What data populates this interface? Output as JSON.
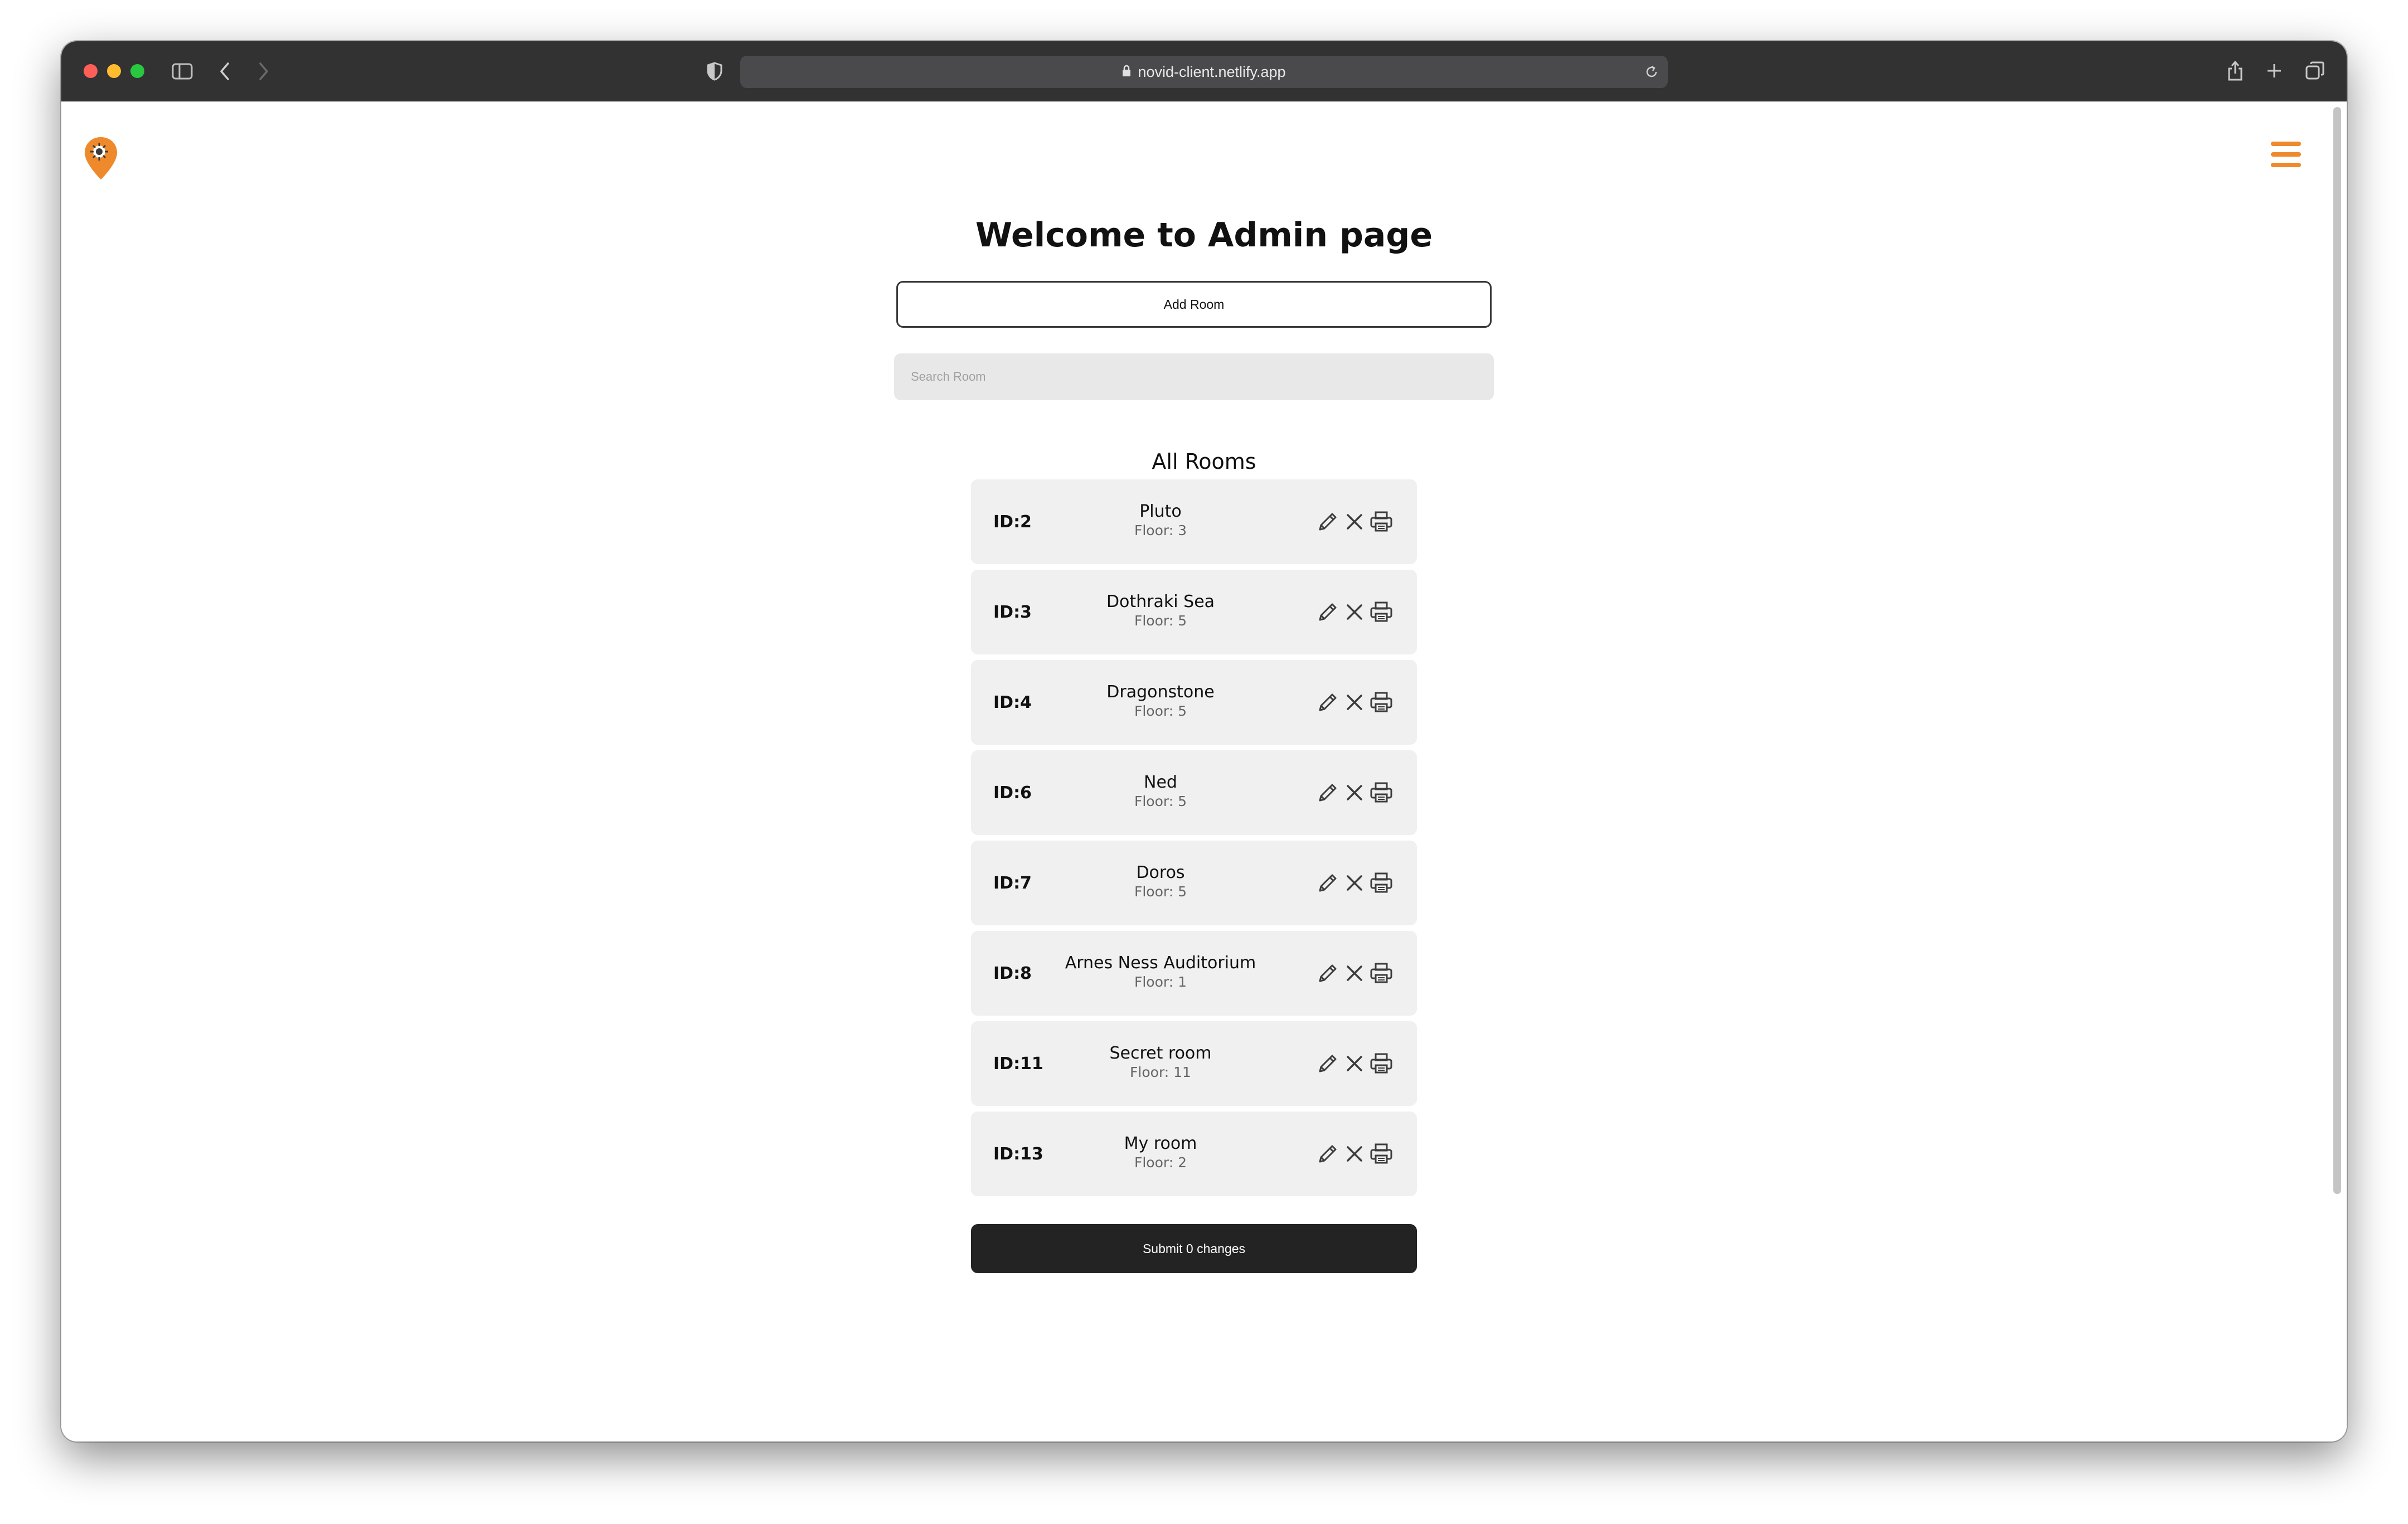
{
  "browser": {
    "url": "novid-client.netlify.app",
    "icons": {
      "sidebar": "sidebar-icon",
      "back": "chevron-left-icon",
      "forward": "chevron-right-icon",
      "shield": "shield-icon",
      "lock": "lock-icon",
      "reload": "reload-icon",
      "share": "share-icon",
      "new_tab": "plus-icon",
      "tabs": "tabs-overview-icon"
    }
  },
  "header": {
    "logo_icon": "location-pin-virus-icon",
    "menu_icon": "hamburger-menu-icon",
    "accent_color": "#ee8a2b"
  },
  "main": {
    "title": "Welcome to Admin page",
    "add_room_label": "Add Room",
    "search_placeholder": "Search Room",
    "search_value": "",
    "section_title": "All Rooms",
    "submit_label": "Submit 0 changes"
  },
  "rooms": [
    {
      "id": "ID:2",
      "name": "Pluto",
      "floor": "Floor: 3"
    },
    {
      "id": "ID:3",
      "name": "Dothraki Sea",
      "floor": "Floor: 5"
    },
    {
      "id": "ID:4",
      "name": "Dragonstone",
      "floor": "Floor: 5"
    },
    {
      "id": "ID:6",
      "name": "Ned",
      "floor": "Floor: 5"
    },
    {
      "id": "ID:7",
      "name": "Doros",
      "floor": "Floor: 5"
    },
    {
      "id": "ID:8",
      "name": "Arnes Ness Auditorium",
      "floor": "Floor: 1"
    },
    {
      "id": "ID:11",
      "name": "Secret room",
      "floor": "Floor: 11"
    },
    {
      "id": "ID:13",
      "name": "My room",
      "floor": "Floor: 2"
    }
  ],
  "room_action_icons": [
    "pencil-icon",
    "close-icon",
    "printer-icon"
  ]
}
